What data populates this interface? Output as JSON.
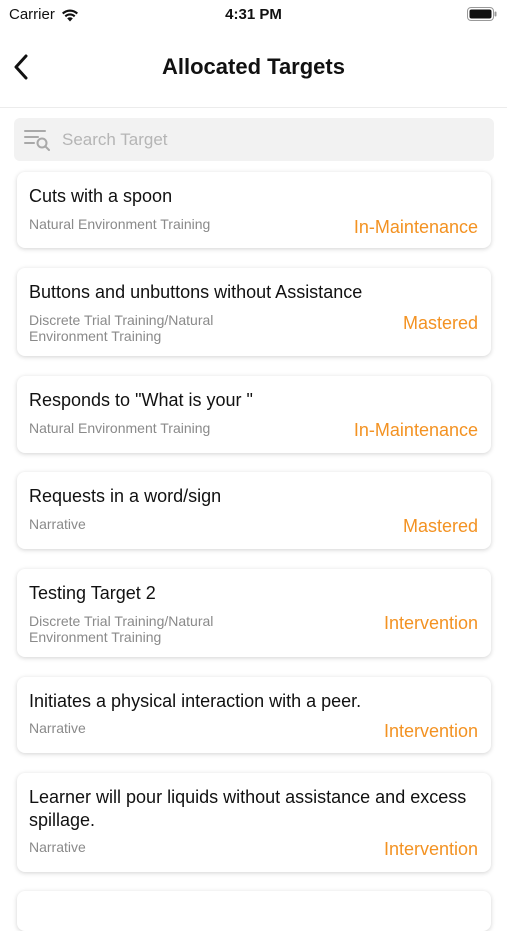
{
  "status_bar": {
    "carrier": "Carrier",
    "time": "4:31 PM"
  },
  "nav": {
    "title": "Allocated Targets"
  },
  "search": {
    "placeholder": "Search Target",
    "value": ""
  },
  "accent_color": "#f39222",
  "targets": [
    {
      "name": "Cuts with a spoon",
      "method": "Natural Environment Training",
      "status": "In-Maintenance"
    },
    {
      "name": "Buttons and unbuttons without Assistance",
      "method": "Discrete Trial Training/Natural Environment Training",
      "status": "Mastered"
    },
    {
      "name": "Responds to \"What is your \"",
      "method": "Natural Environment Training",
      "status": "In-Maintenance"
    },
    {
      "name": "Requests in a word/sign",
      "method": "Narrative",
      "status": "Mastered"
    },
    {
      "name": "Testing Target 2",
      "method": "Discrete Trial Training/Natural Environment Training",
      "status": "Intervention"
    },
    {
      "name": "Initiates a physical interaction with a peer.",
      "method": "Narrative",
      "status": "Intervention"
    },
    {
      "name": "Learner will pour liquids without assistance and excess spillage.",
      "method": "Narrative",
      "status": "Intervention"
    }
  ]
}
